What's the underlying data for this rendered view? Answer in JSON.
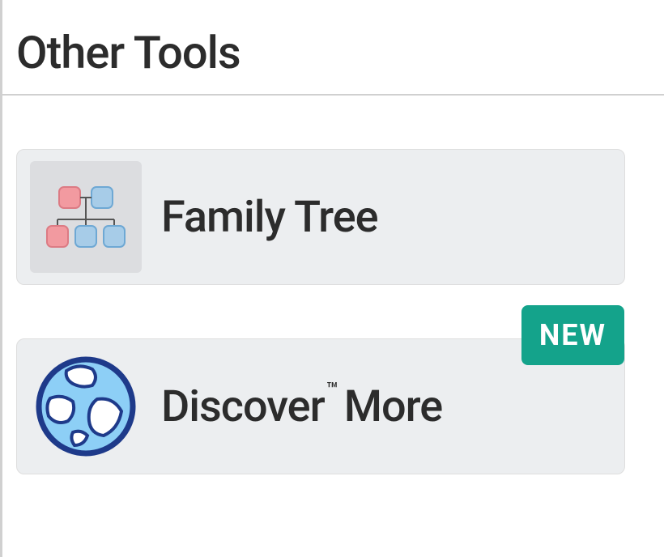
{
  "section": {
    "title": "Other Tools"
  },
  "cards": {
    "family_tree": {
      "label": "Family Tree",
      "icon": "family-tree-icon"
    },
    "discover_more": {
      "label_prefix": "Discover",
      "label_suffix": "More",
      "trademark": "™",
      "icon": "globe-icon",
      "badge": "NEW"
    }
  },
  "colors": {
    "badge_bg": "#14a38b",
    "card_bg": "#eceef0",
    "tree_pink": "#f29aa0",
    "tree_blue": "#a7cce8",
    "globe_blue": "#8dcff6",
    "globe_outline": "#1e3a8a"
  }
}
